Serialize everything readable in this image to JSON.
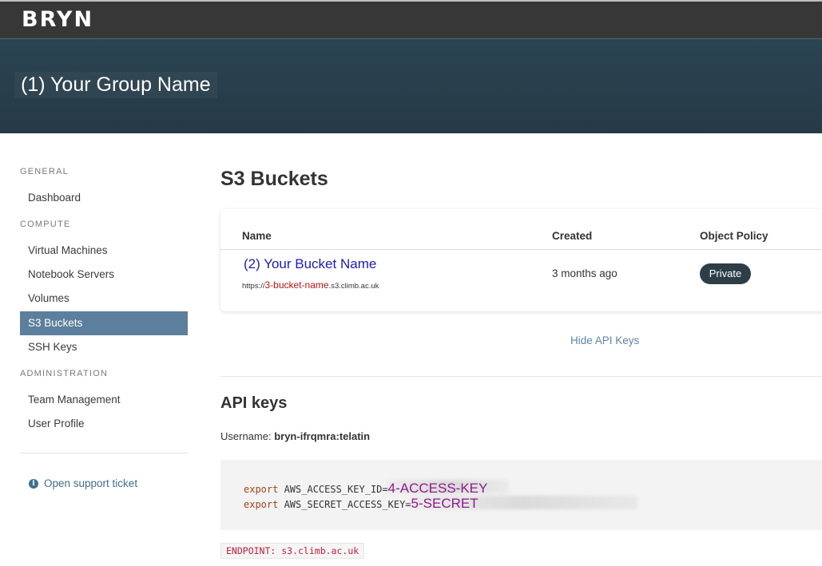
{
  "app": {
    "logo": "BRYN"
  },
  "banner": {
    "group_name": "(1) Your Group Name"
  },
  "sidebar": {
    "sections": [
      {
        "title": "GENERAL",
        "items": [
          "Dashboard"
        ]
      },
      {
        "title": "COMPUTE",
        "items": [
          "Virtual Machines",
          "Notebook Servers",
          "Volumes",
          "S3 Buckets",
          "SSH Keys"
        ]
      },
      {
        "title": "ADMINISTRATION",
        "items": [
          "Team Management",
          "User Profile"
        ]
      }
    ],
    "active_item": "S3 Buckets",
    "support_link": "Open support ticket"
  },
  "main": {
    "title": "S3 Buckets",
    "table": {
      "columns": [
        "Name",
        "Created",
        "Object Policy"
      ],
      "rows": [
        {
          "name": "(2) Your Bucket Name",
          "url_prefix": "https://",
          "url_bucket": "3-bucket-name",
          "url_suffix": ".s3.climb.ac.uk",
          "created": "3 months ago",
          "policy": "Private"
        }
      ]
    },
    "hide_api_keys": "Hide API Keys",
    "api_keys": {
      "title": "API keys",
      "username_label": "Username:",
      "username": "bryn-ifrqmra:telatin",
      "lines": [
        {
          "keyword": "export",
          "var": " AWS_ACCESS_KEY_ID=",
          "value": "4-ACCESS-KEY"
        },
        {
          "keyword": "export",
          "var": " AWS_SECRET_ACCESS_KEY=",
          "value": "5-SECRET"
        }
      ],
      "endpoint": "ENDPOINT: s3.climb.ac.uk"
    }
  },
  "colors": {
    "topbar": "#373737",
    "banner": "#2b4452",
    "active_nav": "#5b7f9c",
    "link": "#5a86aa",
    "badge": "#2e3e48",
    "annotation_blue": "#1a1acc",
    "annotation_red": "#cc1111",
    "annotation_purple": "#8b1a8b"
  },
  "icons": {
    "support": "info-circle-icon"
  }
}
